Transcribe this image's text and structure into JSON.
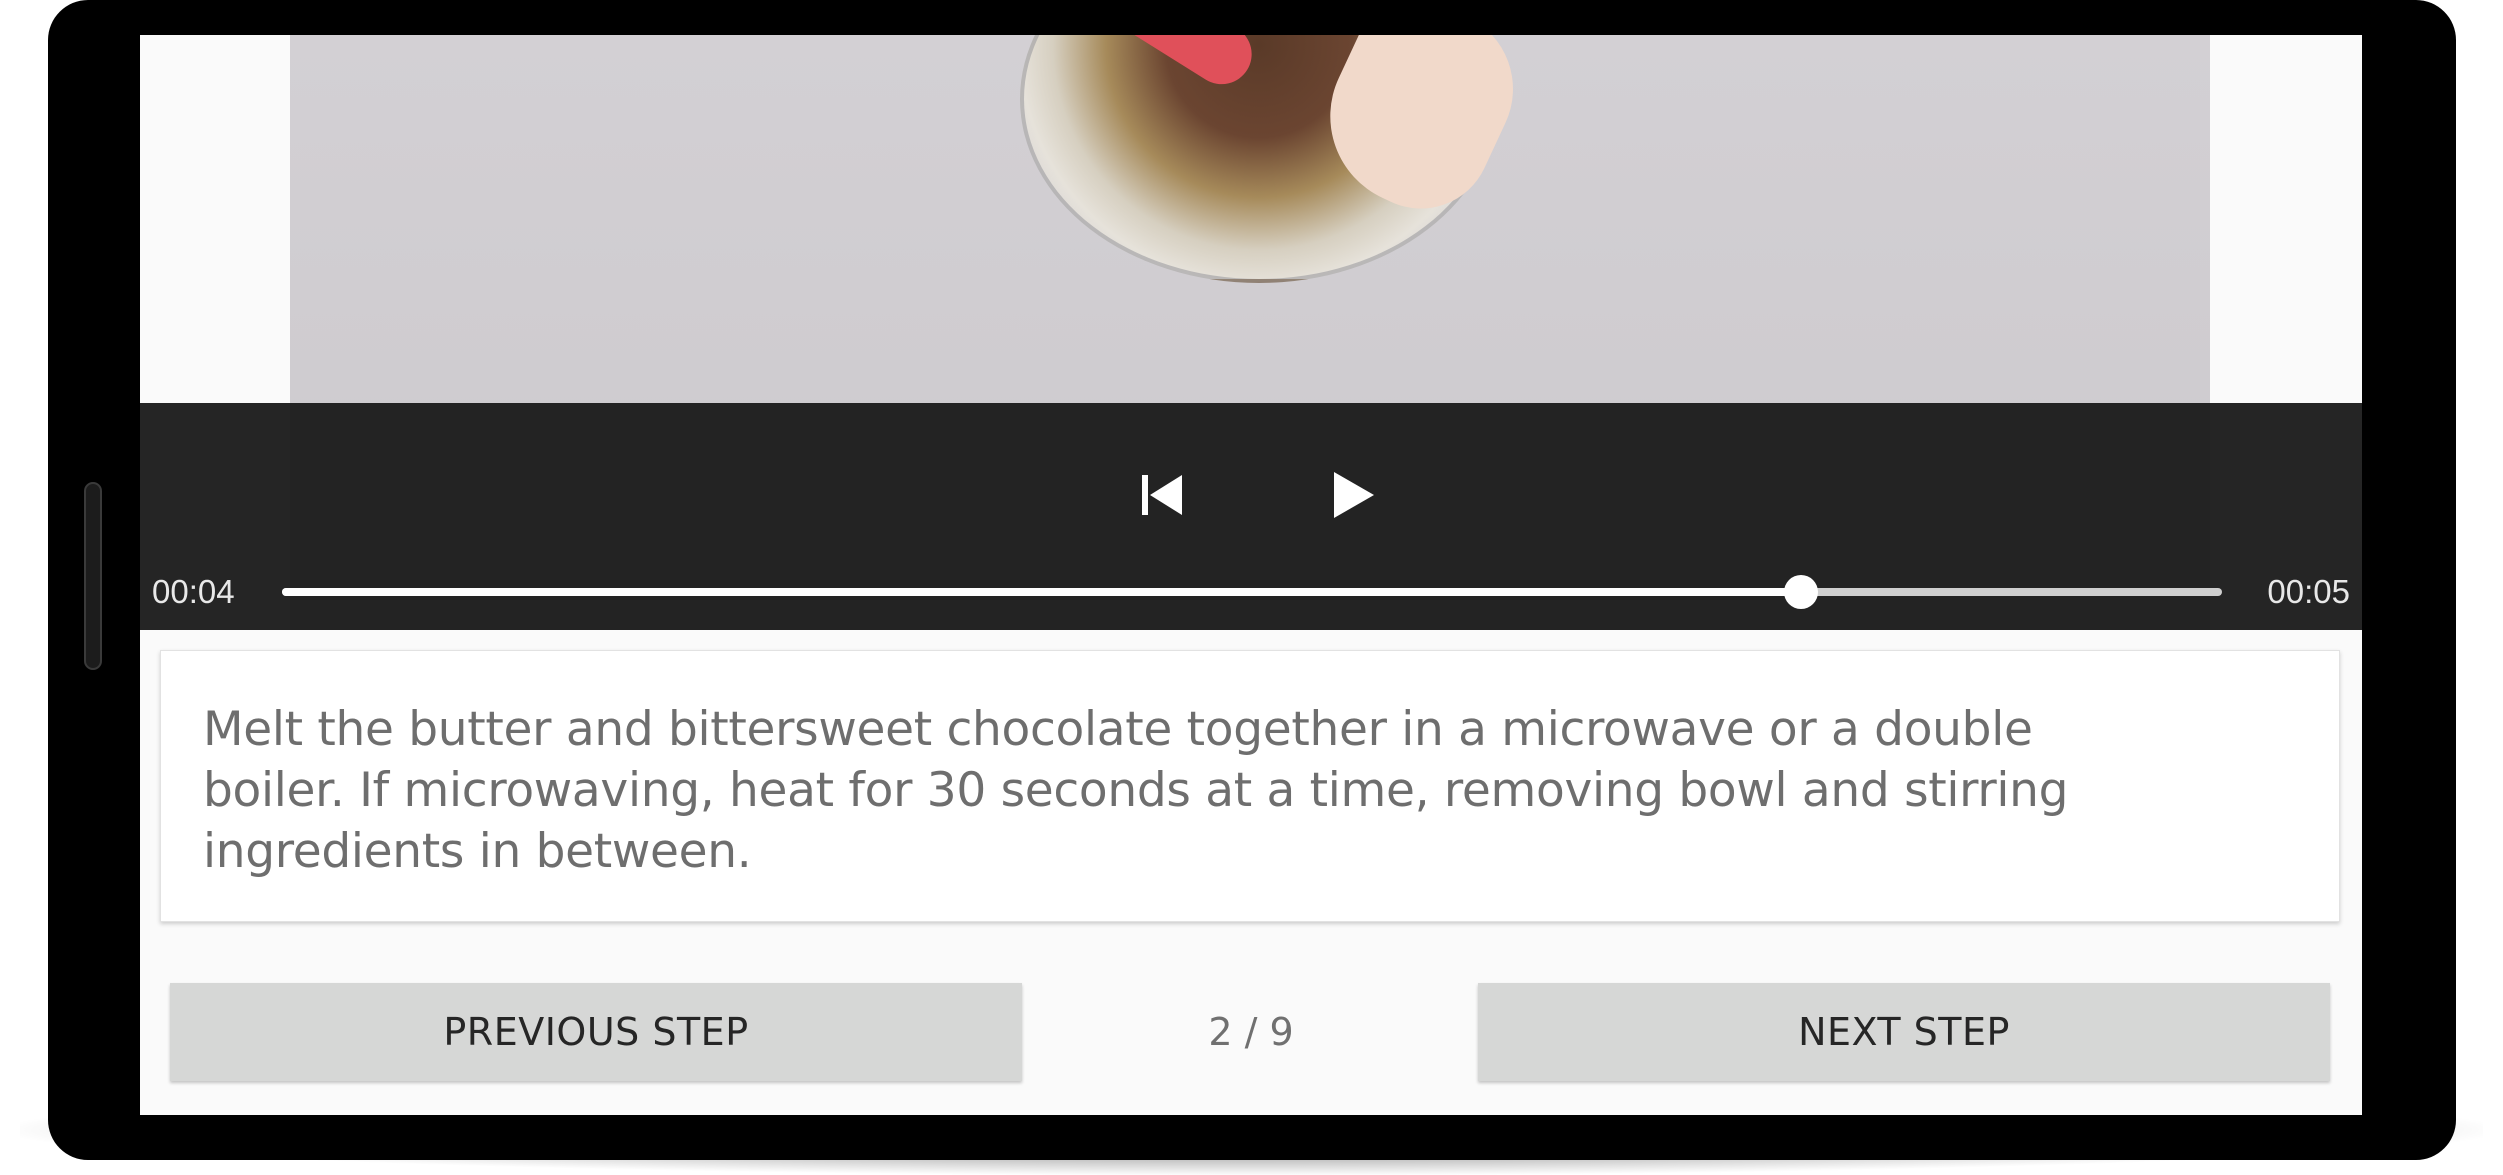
{
  "player": {
    "current_time": "00:04",
    "duration": "00:05",
    "progress_fraction": 0.783,
    "controls": {
      "previous_icon": "skip-previous-icon",
      "play_icon": "play-icon"
    }
  },
  "step": {
    "description": "Melt the butter and bittersweet chocolate together in a microwave or a double boiler. If microwaving, heat for 30 seconds at a time, removing bowl and stirring ingredients in between.",
    "counter": "2 / 9"
  },
  "navigation": {
    "previous_label": "PREVIOUS STEP",
    "next_label": "NEXT STEP"
  },
  "colors": {
    "controls_background": "#1c1c1c",
    "button_background": "#d6d7d6",
    "description_text": "#6e6e6e"
  }
}
